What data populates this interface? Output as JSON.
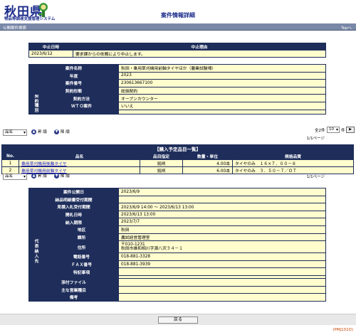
{
  "header": {
    "logo_title": "秋田県",
    "logo_sub": "物品等調達支援管理システム",
    "page_title": "案件情報詳細"
  },
  "bar": {
    "left": "公開案件検索",
    "right": "Topへ"
  },
  "suspension": {
    "headers": [
      "中止日時",
      "中止理由"
    ],
    "date": "2023/6/12",
    "reason": "要求課からの依頼により中止します。"
  },
  "case": {
    "name_label": "案件名称",
    "name": "秋田・乗用草刈機用前軸タイヤほか（農業試験場）",
    "year_label": "年度",
    "year": "2023",
    "number_label": "案件番号",
    "number": "230613667100",
    "type_label": "契約形態",
    "type": "総価契約",
    "group_label": "契約種別",
    "method_label": "契約方法",
    "method": "オープンカウンター",
    "wto_label": "ＷＴＯ案件",
    "wto": "いいえ"
  },
  "sort": {
    "selected": "品名",
    "asc": "昇 順",
    "desc": "降 順",
    "total": "全2件",
    "per_page": "10",
    "per_page_unit": "件",
    "go": "▶",
    "page_info": "1/1ページ"
  },
  "items": {
    "title": "【購入予定品目一覧】",
    "headers": [
      "No.",
      "品名",
      "品目指定",
      "数量・単位",
      "規格品質"
    ],
    "rows": [
      {
        "no": "1",
        "name": "乗用草刈機用後軸タイヤ",
        "spec_type": "銘柄",
        "qty": "4.00本",
        "spec": "タイヤのみ　１６×７．００－８"
      },
      {
        "no": "2",
        "name": "乗用草刈機用前軸タイヤ",
        "spec_type": "銘柄",
        "qty": "6.00本",
        "spec": "タイヤのみ　３．５０－７／ＯＴ"
      }
    ]
  },
  "details": {
    "publish_label": "案件公開日",
    "publish": "2023/6/9",
    "deadline_label": "納品明細書受付期間",
    "deadline": "",
    "quote_label": "見積入札受付期間",
    "quote": "2023/6/9 14:00 ～ 2023/6/13 13:00",
    "open_label": "開札日時",
    "open": "2023/6/13 13:00",
    "delivery_label": "納入期限",
    "delivery": "2023/7/7",
    "group_label": "代表納入先",
    "region_label": "地区",
    "region": "秋田",
    "dept_label": "課所",
    "dept": "農試経営管理室",
    "addr_label": "住所",
    "addr_zip": "〒010-1231",
    "addr": "秋田市雄和相川字源八沢３４－１",
    "tel_label": "電話番号",
    "tel": "018-881-3328",
    "fax_label": "ＦＡＸ番号",
    "fax": "018-881-3939",
    "note_label": "特記事項",
    "note": "",
    "attach_label": "添付ファイル",
    "attach": "",
    "biz_label": "主な営業種目",
    "biz": "",
    "remarks_label": "備考",
    "remarks": ""
  },
  "footer": {
    "back": "戻る",
    "page_id": "(PMJ101D)"
  },
  "colors": {
    "navy": "#1e2d5a",
    "yellow": "#fffccd",
    "bar": "#7a88a8",
    "brand": "#1a2a8a"
  }
}
